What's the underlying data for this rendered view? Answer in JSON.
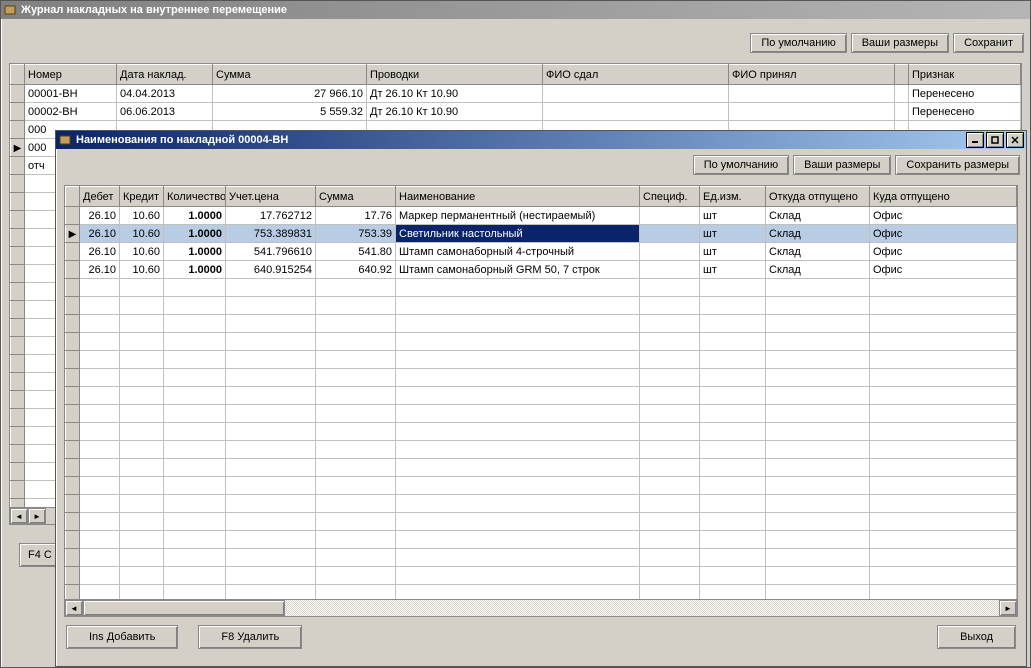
{
  "outer_window": {
    "title": "Журнал накладных на внутреннее перемещение",
    "buttons": {
      "defaults": "По умолчанию",
      "your_sizes": "Ваши размеры",
      "save_sizes": "Сохранит"
    },
    "columns": [
      "Номер",
      "Дата наклад.",
      "Сумма",
      "Проводки",
      "ФИО сдал",
      "ФИО принял",
      "",
      "Признак"
    ],
    "rows": [
      {
        "num": "00001-ВН",
        "date": "04.04.2013",
        "sum": "27 966.10",
        "post": "Дт 26.10 Кт 10.90",
        "f1": "",
        "f2": "",
        "blank": "",
        "flag": "Перенесено"
      },
      {
        "num": "00002-ВН",
        "date": "06.06.2013",
        "sum": "5 559.32",
        "post": "Дт 26.10 Кт 10.90",
        "f1": "",
        "f2": "",
        "blank": "",
        "flag": "Перенесено"
      }
    ],
    "partial_rows": [
      "000",
      "000",
      "отч"
    ],
    "footer_btn_partial": "F4 C"
  },
  "inner_window": {
    "title": "Наименования по накладной 00004-ВН",
    "buttons": {
      "defaults": "По умолчанию",
      "your_sizes": "Ваши размеры",
      "save_sizes": "Сохранить размеры"
    },
    "columns": [
      "Дебет",
      "Кредит",
      "Количество",
      "Учет.цена",
      "Сумма",
      "Наименование",
      "Специф.",
      "Ед.изм.",
      "Откуда отпущено",
      "Куда отпущено"
    ],
    "rows": [
      {
        "debit": "26.10",
        "credit": "10.60",
        "qty": "1.0000",
        "price": "17.762712",
        "sum": "17.76",
        "name": "Маркер перманентный (нестираемый)",
        "spec": "",
        "unit": "шт",
        "from": "Склад",
        "to": "Офис",
        "selected": false
      },
      {
        "debit": "26.10",
        "credit": "10.60",
        "qty": "1.0000",
        "price": "753.389831",
        "sum": "753.39",
        "name": "Светильник настольный",
        "spec": "",
        "unit": "шт",
        "from": "Склад",
        "to": "Офис",
        "selected": true
      },
      {
        "debit": "26.10",
        "credit": "10.60",
        "qty": "1.0000",
        "price": "541.796610",
        "sum": "541.80",
        "name": "Штамп самонаборный 4-строчный",
        "spec": "",
        "unit": "шт",
        "from": "Склад",
        "to": "Офис",
        "selected": false
      },
      {
        "debit": "26.10",
        "credit": "10.60",
        "qty": "1.0000",
        "price": "640.915254",
        "sum": "640.92",
        "name": "Штамп самонаборный GRM 50, 7 строк",
        "spec": "",
        "unit": "шт",
        "from": "Склад",
        "to": "Офис",
        "selected": false
      }
    ],
    "footer": {
      "add": "Ins Добавить",
      "delete": "F8 Удалить",
      "exit": "Выход"
    }
  }
}
